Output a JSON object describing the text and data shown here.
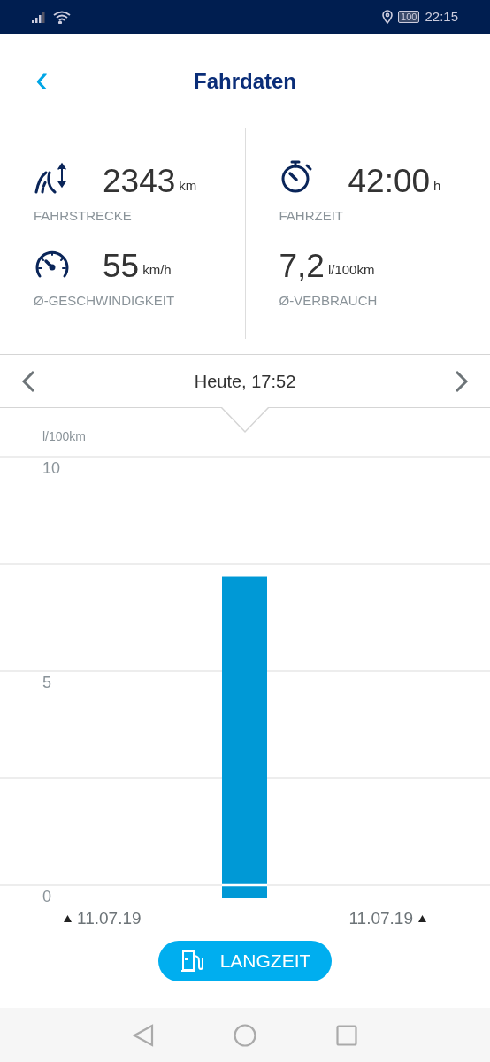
{
  "status_bar": {
    "battery": "100",
    "time": "22:15"
  },
  "header": {
    "back": "‹",
    "title": "Fahrdaten"
  },
  "stats": [
    {
      "kind": "distance",
      "value": "2343",
      "unit": "km",
      "label": "FAHRSTRECKE"
    },
    {
      "kind": "time",
      "value": "42:00",
      "unit": "h",
      "label": "FAHRZEIT"
    },
    {
      "kind": "speed",
      "value": "55",
      "unit": "km/h",
      "label": "Ø-GESCHWINDIGKEIT"
    },
    {
      "kind": "consumption",
      "value": "7,2",
      "unit": "l/100km",
      "label": "Ø-VERBRAUCH"
    }
  ],
  "period_nav": {
    "label": "Heute, 17:52"
  },
  "chart": {
    "range_start": "11.07.19",
    "range_end": "11.07.19",
    "chart_data": {
      "type": "bar",
      "ylabel": "l/100km",
      "ylim": [
        0,
        10
      ],
      "yticks": [
        0,
        5,
        10
      ],
      "series": [
        {
          "color": "#0099d6",
          "values": [
            7.2
          ]
        }
      ]
    }
  },
  "button": {
    "label": "LANGZEIT"
  }
}
